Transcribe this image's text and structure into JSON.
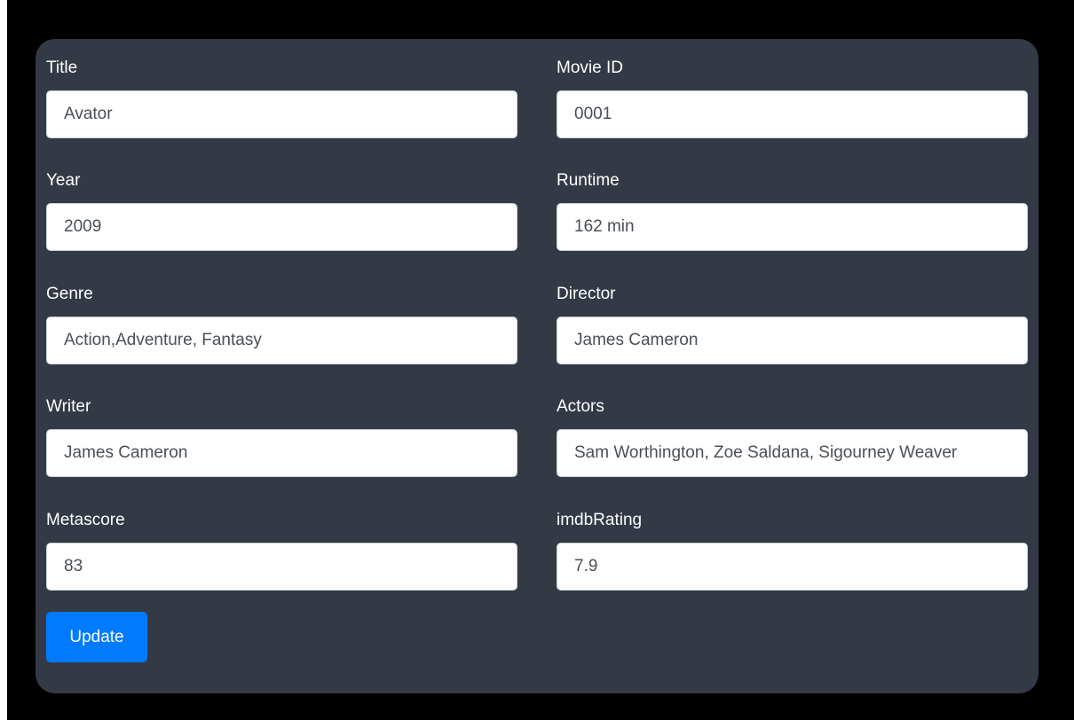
{
  "form": {
    "fields": [
      {
        "label": "Title",
        "value": "Avator"
      },
      {
        "label": "Movie ID",
        "value": "0001"
      },
      {
        "label": "Year",
        "value": "2009"
      },
      {
        "label": "Runtime",
        "value": "162 min"
      },
      {
        "label": "Genre",
        "value": "Action,Adventure, Fantasy"
      },
      {
        "label": "Director",
        "value": "James Cameron"
      },
      {
        "label": "Writer",
        "value": "James Cameron"
      },
      {
        "label": "Actors",
        "value": "Sam Worthington, Zoe Saldana, Sigourney Weaver"
      },
      {
        "label": "Metascore",
        "value": "83"
      },
      {
        "label": "imdbRating",
        "value": "7.9"
      }
    ],
    "submit_label": "Update"
  },
  "colors": {
    "page_background": "#000000",
    "card_background": "#343a45",
    "label_text": "#ffffff",
    "input_background": "#ffffff",
    "input_text": "#495057",
    "button_background": "#007bff",
    "button_text": "#ffffff"
  }
}
